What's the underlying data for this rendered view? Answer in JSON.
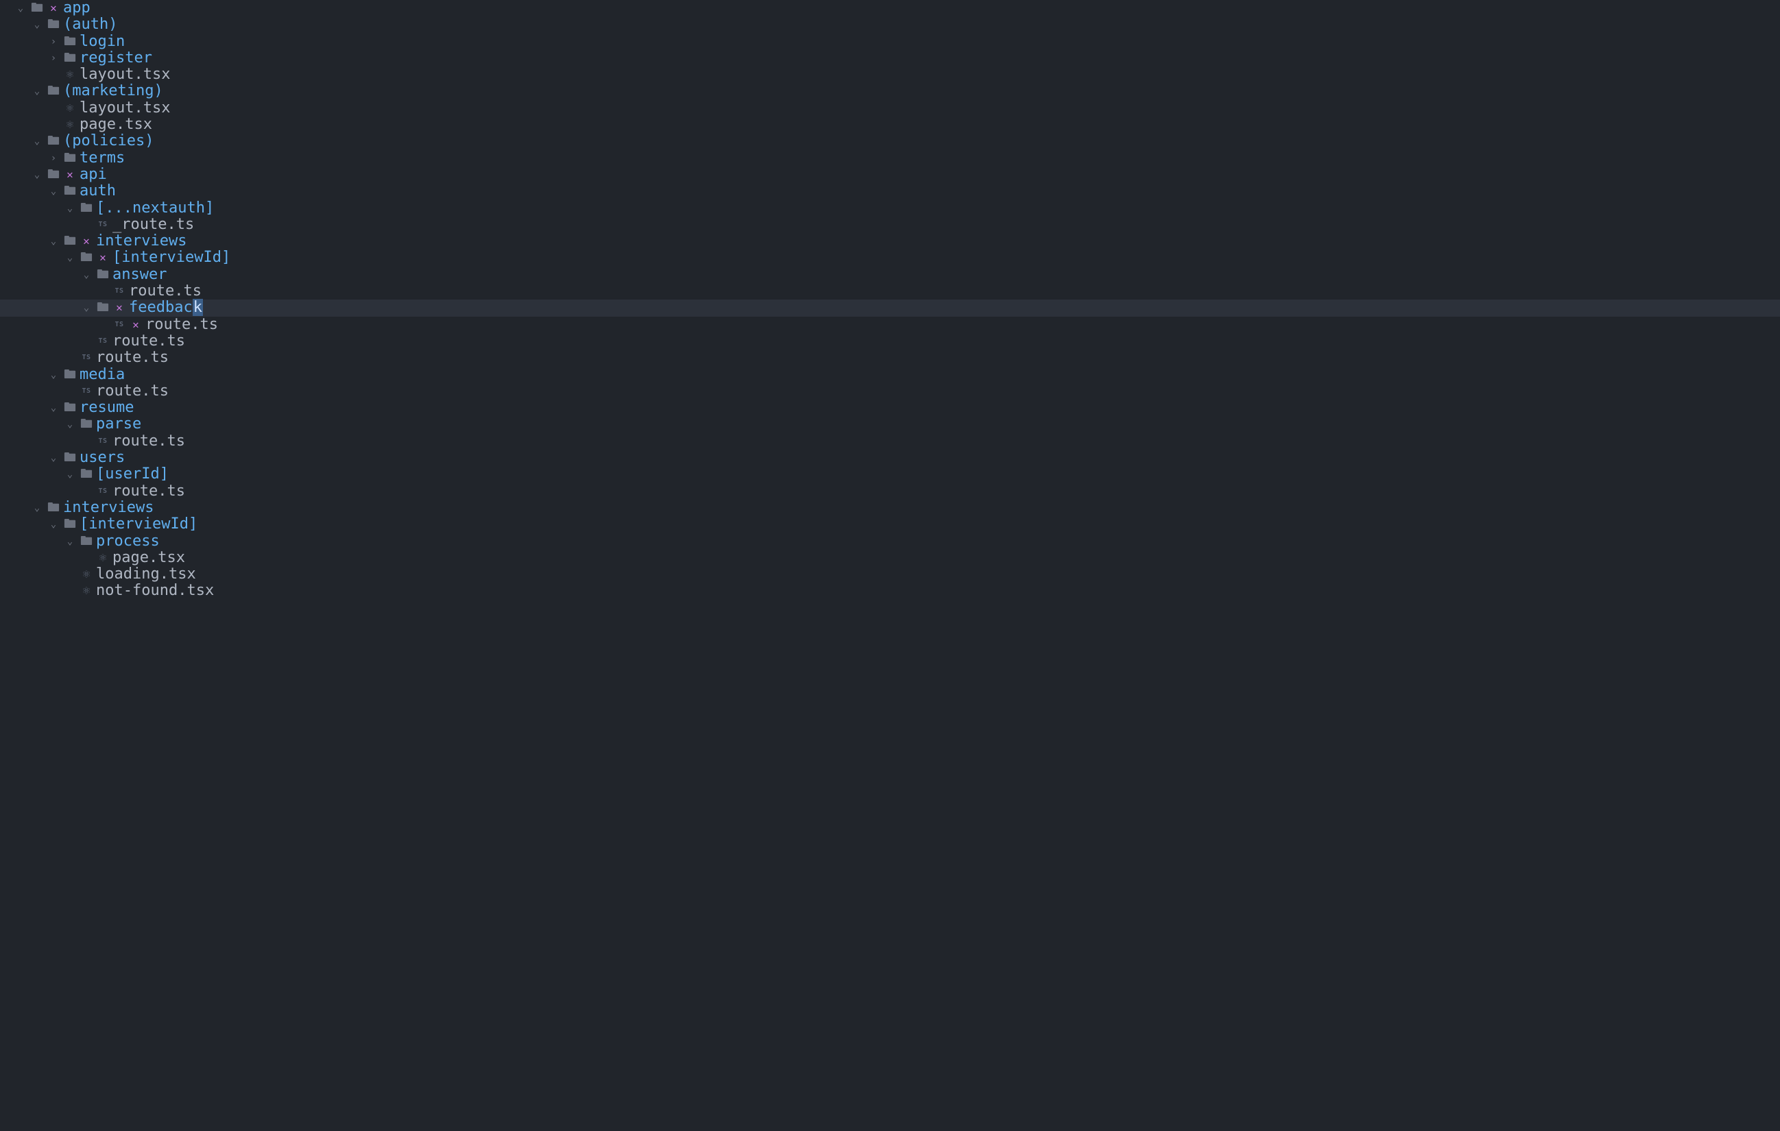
{
  "glyphs": {
    "chev_down": "⌄",
    "chev_right": "›",
    "folder_open": "🖿",
    "folder_closed": "🖿",
    "react": "⚛",
    "ts": "TS",
    "pink_x": "✕"
  },
  "tree": [
    {
      "depth": 0,
      "chev": "down",
      "icons": [
        "folder_open",
        "pink_x"
      ],
      "label": "app",
      "type": "dir"
    },
    {
      "depth": 1,
      "chev": "down",
      "icons": [
        "folder_open"
      ],
      "label": "(auth)",
      "type": "dir"
    },
    {
      "depth": 2,
      "chev": "right",
      "icons": [
        "folder_closed"
      ],
      "label": "login",
      "type": "dir"
    },
    {
      "depth": 2,
      "chev": "right",
      "icons": [
        "folder_closed"
      ],
      "label": "register",
      "type": "dir"
    },
    {
      "depth": 2,
      "chev": "none",
      "icons": [
        "react"
      ],
      "label": "layout.tsx",
      "type": "file"
    },
    {
      "depth": 1,
      "chev": "down",
      "icons": [
        "folder_open"
      ],
      "label": "(marketing)",
      "type": "dir"
    },
    {
      "depth": 2,
      "chev": "none",
      "icons": [
        "react"
      ],
      "label": "layout.tsx",
      "type": "file"
    },
    {
      "depth": 2,
      "chev": "none",
      "icons": [
        "react"
      ],
      "label": "page.tsx",
      "type": "file"
    },
    {
      "depth": 1,
      "chev": "down",
      "icons": [
        "folder_open"
      ],
      "label": "(policies)",
      "type": "dir"
    },
    {
      "depth": 2,
      "chev": "right",
      "icons": [
        "folder_closed"
      ],
      "label": "terms",
      "type": "dir"
    },
    {
      "depth": 1,
      "chev": "down",
      "icons": [
        "folder_open",
        "pink_x"
      ],
      "label": "api",
      "type": "dir"
    },
    {
      "depth": 2,
      "chev": "down",
      "icons": [
        "folder_open"
      ],
      "label": "auth",
      "type": "dir"
    },
    {
      "depth": 3,
      "chev": "down",
      "icons": [
        "folder_open"
      ],
      "label": "[...nextauth]",
      "type": "dir"
    },
    {
      "depth": 4,
      "chev": "none",
      "icons": [
        "ts"
      ],
      "label": "_route.ts",
      "type": "file"
    },
    {
      "depth": 2,
      "chev": "down",
      "icons": [
        "folder_open",
        "pink_x"
      ],
      "label": "interviews",
      "type": "dir"
    },
    {
      "depth": 3,
      "chev": "down",
      "icons": [
        "folder_open",
        "pink_x"
      ],
      "label": "[interviewId]",
      "type": "dir"
    },
    {
      "depth": 4,
      "chev": "down",
      "icons": [
        "folder_open"
      ],
      "label": "answer",
      "type": "dir"
    },
    {
      "depth": 5,
      "chev": "none",
      "icons": [
        "ts"
      ],
      "label": "route.ts",
      "type": "file"
    },
    {
      "depth": 4,
      "chev": "down",
      "icons": [
        "folder_open",
        "pink_x"
      ],
      "label_pre": "feedbac",
      "label_cursor": "k",
      "type": "dir",
      "selected": true,
      "special": "cursor"
    },
    {
      "depth": 5,
      "chev": "none",
      "icons": [
        "ts",
        "pink_x"
      ],
      "label": "route.ts",
      "type": "file"
    },
    {
      "depth": 4,
      "chev": "none",
      "icons": [
        "ts"
      ],
      "label": "route.ts",
      "type": "file"
    },
    {
      "depth": 3,
      "chev": "none",
      "icons": [
        "ts"
      ],
      "label": "route.ts",
      "type": "file"
    },
    {
      "depth": 2,
      "chev": "down",
      "icons": [
        "folder_open"
      ],
      "label": "media",
      "type": "dir"
    },
    {
      "depth": 3,
      "chev": "none",
      "icons": [
        "ts"
      ],
      "label": "route.ts",
      "type": "file"
    },
    {
      "depth": 2,
      "chev": "down",
      "icons": [
        "folder_open"
      ],
      "label": "resume",
      "type": "dir"
    },
    {
      "depth": 3,
      "chev": "down",
      "icons": [
        "folder_open"
      ],
      "label": "parse",
      "type": "dir"
    },
    {
      "depth": 4,
      "chev": "none",
      "icons": [
        "ts"
      ],
      "label": "route.ts",
      "type": "file"
    },
    {
      "depth": 2,
      "chev": "down",
      "icons": [
        "folder_open"
      ],
      "label": "users",
      "type": "dir"
    },
    {
      "depth": 3,
      "chev": "down",
      "icons": [
        "folder_open"
      ],
      "label": "[userId]",
      "type": "dir"
    },
    {
      "depth": 4,
      "chev": "none",
      "icons": [
        "ts"
      ],
      "label": "route.ts",
      "type": "file"
    },
    {
      "depth": 1,
      "chev": "down",
      "icons": [
        "folder_open"
      ],
      "label": "interviews",
      "type": "dir"
    },
    {
      "depth": 2,
      "chev": "down",
      "icons": [
        "folder_open"
      ],
      "label": "[interviewId]",
      "type": "dir"
    },
    {
      "depth": 3,
      "chev": "down",
      "icons": [
        "folder_open"
      ],
      "label": "process",
      "type": "dir"
    },
    {
      "depth": 4,
      "chev": "none",
      "icons": [
        "react"
      ],
      "label": "page.tsx",
      "type": "file"
    },
    {
      "depth": 3,
      "chev": "none",
      "icons": [
        "react"
      ],
      "label": "loading.tsx",
      "type": "file"
    },
    {
      "depth": 3,
      "chev": "none",
      "icons": [
        "react"
      ],
      "label": "not-found.tsx",
      "type": "file"
    }
  ]
}
